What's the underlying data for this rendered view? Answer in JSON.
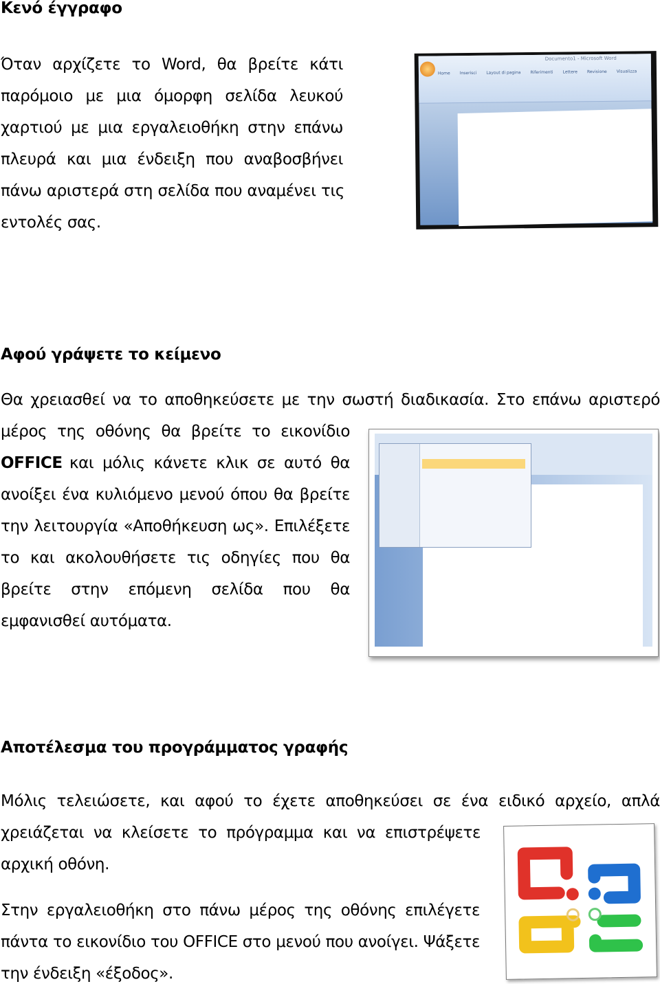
{
  "sections": [
    {
      "heading": "Κενό έγγραφο",
      "lines": [
        "Όταν αρχίζετε το Word, θα βρείτε κάτι",
        "παρόμοιο με μια όμορφη σελίδα λευκού",
        "χαρτιού με μια εργαλειοθήκη στην επάνω",
        "πλευρά και μια ένδειξη που αναβοσβήνει",
        "πάνω αριστερά στη σελίδα που αναμένει τις",
        "εντολές σας."
      ]
    },
    {
      "heading": "Αφού γράψετε το κείμενο",
      "lines": [
        "Θα χρειασθεί να το αποθηκεύσετε με την σωστή διαδικασία. Στο επάνω αριστερό",
        "μέρος της οθόνης θα βρείτε το εικονίδιο",
        "OFFICE",
        "και μόλις κάνετε κλικ σε αυτό θα",
        "ανοίξει ένα κυλιόμενο μενού όπου θα βρείτε",
        "την λειτουργία «Αποθήκευση ως». Επιλέξετε",
        "το και ακολουθήσετε τις οδηγίες που θα",
        "βρείτε στην επόμενη σελίδα που θα",
        "εμφανισθεί αυτόματα."
      ]
    },
    {
      "heading": "Αποτέλεσμα του προγράμματος γραφής",
      "lines": [
        "Μόλις τελειώσετε, και αφού το έχετε αποθηκεύσει σε ένα ειδικό αρχείο, απλά",
        "χρειάζεται να κλείσετε το πρόγραμμα και να επιστρέψετε στην",
        "αρχική οθόνη.",
        "Στην εργαλειοθήκη στο πάνω μέρος της οθόνης επιλέγετε",
        "πάντα το εικονίδιο του OFFICE στο μενού που ανοίγει. Ψάξετε",
        "την ένδειξη «έξοδος»."
      ]
    }
  ],
  "screenshot1": {
    "title": "Documento1 - Microsoft Word",
    "tabs": [
      "Home",
      "Inserisci",
      "Layout di pagina",
      "Riferimenti",
      "Lettere",
      "Revisione",
      "Visualizza"
    ]
  },
  "logo_colors": [
    "#e0322a",
    "#1f6fd0",
    "#f2c21c",
    "#2fc24a"
  ]
}
